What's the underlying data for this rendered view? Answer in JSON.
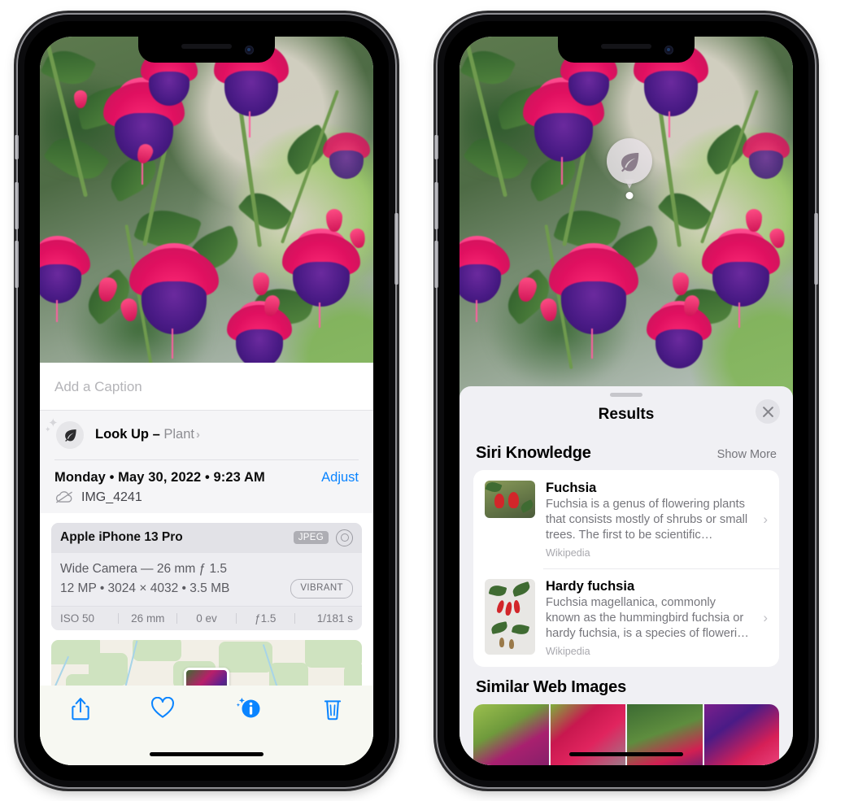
{
  "left_phone": {
    "caption": {
      "placeholder": "Add a Caption",
      "value": ""
    },
    "look_up": {
      "label": "Look Up – ",
      "subject": "Plant",
      "chevron": "›",
      "icon": "leaf-icon"
    },
    "date": "Monday • May 30, 2022 • 9:23 AM",
    "adjust_label": "Adjust",
    "file_name": "IMG_4241",
    "cloud_icon": "cloud-slash-icon",
    "camera": {
      "device": "Apple iPhone 13 Pro",
      "format_badge": "JPEG",
      "lens_icon": "lens-icon",
      "lens_line": "Wide Camera — 26 mm ƒ 1.5",
      "specs_line": "12 MP • 3024 × 4032 • 3.5 MB",
      "style_badge": "VIBRANT",
      "exif": [
        "ISO 50",
        "26 mm",
        "0 ev",
        "ƒ1.5",
        "1/181 s"
      ]
    },
    "toolbar": [
      {
        "name": "share-button",
        "icon": "share-icon"
      },
      {
        "name": "favorite-button",
        "icon": "heart-icon"
      },
      {
        "name": "info-button",
        "icon": "info-sparkle-icon"
      },
      {
        "name": "delete-button",
        "icon": "trash-icon"
      }
    ]
  },
  "right_phone": {
    "visual_lookup_badge": {
      "icon": "leaf-icon"
    },
    "sheet": {
      "title": "Results",
      "close_label": "✕",
      "sections": [
        {
          "title": "Siri Knowledge",
          "action": "Show More",
          "items": [
            {
              "title": "Fuchsia",
              "description": "Fuchsia is a genus of flowering plants that consists mostly of shrubs or small trees. The first to be scientific…",
              "source": "Wikipedia",
              "chevron": "›"
            },
            {
              "title": "Hardy fuchsia",
              "description": "Fuchsia magellanica, commonly known as the hummingbird fuchsia or hardy fuchsia, is a species of floweri…",
              "source": "Wikipedia",
              "chevron": "›"
            }
          ]
        },
        {
          "title": "Similar Web Images",
          "action": "",
          "items": []
        }
      ]
    }
  },
  "colors": {
    "accent_blue": "#0a84ff",
    "sheet_gray": "#f0f0f4",
    "card_white": "#ffffff",
    "secondary_text": "#76767c"
  }
}
